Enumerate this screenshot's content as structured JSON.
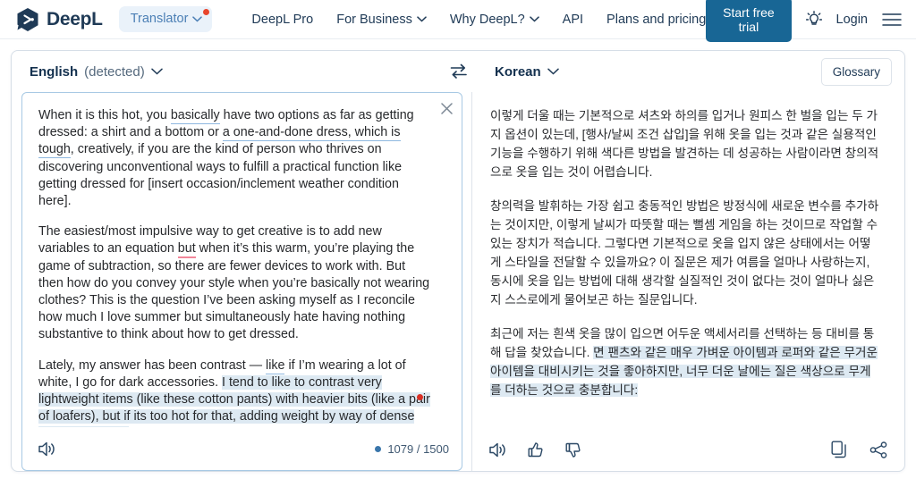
{
  "header": {
    "brand": "DeepL",
    "logo_icon": "deepl-logo-icon",
    "product_pill": {
      "label": "Translator",
      "chevron_icon": "chevron-down-icon",
      "notification_dot": true,
      "badge_color": "#e8452c",
      "background": "#eaf2fa",
      "text_color": "#4b7fb5"
    },
    "nav": [
      {
        "label": "DeepL Pro",
        "has_chevron": false
      },
      {
        "label": "For Business",
        "has_chevron": true
      },
      {
        "label": "Why DeepL?",
        "has_chevron": true
      },
      {
        "label": "API",
        "has_chevron": false
      },
      {
        "label": "Plans and pricing",
        "has_chevron": false
      }
    ],
    "cta_label": "Start free trial",
    "cta_color": "#186695",
    "lightbulb_icon": "lightbulb-icon",
    "login_label": "Login",
    "menu_icon": "hamburger-menu-icon"
  },
  "translator": {
    "source_lang": {
      "name": "English",
      "detected_suffix": "(detected)",
      "chevron_icon": "chevron-down-icon"
    },
    "swap_icon": "swap-languages-icon",
    "target_lang": {
      "name": "Korean",
      "chevron_icon": "chevron-down-icon"
    },
    "glossary_label": "Glossary",
    "close_icon": "close-icon",
    "source": {
      "paragraphs": [
        [
          {
            "t": "When it is this hot, you "
          },
          {
            "t": "basically",
            "style": "suggestion"
          },
          {
            "t": " have two options as far as getting dressed: a shirt and a bottom or "
          },
          {
            "t": "a one-and-done dress, which is tough",
            "style": "suggestion"
          },
          {
            "t": ", creatively, if you are the kind of person who thrives on discovering unconventional ways to fulfill a practical function like getting dressed for [insert occasion/inclement weather condition here]."
          }
        ],
        [
          {
            "t": "The easiest/most impulsive way to get creative is to add new variables to an equation "
          },
          {
            "t": "but",
            "style": "error"
          },
          {
            "t": " when it’s this warm, you’re playing the game of subtraction, so there are fewer devices to work with. But then how do you convey your style when you’re basically not wearing clothes? This is the question I’ve been asking myself as I reconcile how much I love summer but simultaneously hate having nothing substantive to think about how to get dressed."
          }
        ],
        [
          {
            "t": "Lately, my answer has been contrast — "
          },
          {
            "t": "like",
            "style": "suggestion"
          },
          {
            "t": " if I’m wearing a lot of white, I go for dark accessories. "
          },
          {
            "t": "I tend to like to contrast very lightweight items (like these cotton pants) with heavier bits (like a pair of loafers), but if its too hot for that, adding weight by way of dense color is enough:",
            "style": "selected"
          }
        ]
      ],
      "speaker_icon": "speaker-icon",
      "char_count": "1079 / 1500",
      "count_dot_color": "#3a76ab",
      "marker_dot_color": "#d93025"
    },
    "target": {
      "paragraphs": [
        [
          {
            "t": "이렇게 더울 때는 기본적으로 셔츠와 하의를 입거나 원피스 한 벌을 입는 두 가지 옵션이 있는데, [행사/날씨 조건 삽입]을 위해 옷을 입는 것과 같은 실용적인 기능을 수행하기 위해 색다른 방법을 발견하는 데 성공하는 사람이라면 창의적으로 옷을 입는 것이 어렵습니다."
          }
        ],
        [
          {
            "t": "창의력을 발휘하는 가장 쉽고 충동적인 방법은 방정식에 새로운 변수를 추가하는 것이지만, 이렇게 날씨가 따뜻할 때는 뻘셈 게임을 하는 것이므로 작업할 수 있는 장치가 적습니다. 그렇다면 기본적으로 옷을 입지 않은 상태에서는 어떻게 스타일을 전달할 수 있을까요? 이 질문은 제가 여름을 얼마나 사랑하는지, 동시에 옷을 입는 방법에 대해 생각할 실질적인 것이 없다는 것이 얼마나 싫은지 스스로에게 물어보곤 하는 질문입니다."
          }
        ],
        [
          {
            "t": "최근에 저는 흰색 옷을 많이 입으면 어두운 액세서리를 선택하는 등 대비를 통해 답을 찾았습니다. "
          },
          {
            "t": "면 팬츠와 같은 매우 가벼운 아이템과 로퍼와 같은 무거운 아이템을 대비시키는 것을 좋아하지만, 너무 더운 날에는 질은 색상으로 무게를 더하는 것으로 충분합니다:",
            "style": "selected"
          }
        ]
      ],
      "speaker_icon": "speaker-icon",
      "thumbs_up_icon": "thumbs-up-icon",
      "thumbs_down_icon": "thumbs-down-icon",
      "copy_icon": "copy-icon",
      "share_icon": "share-icon"
    }
  }
}
